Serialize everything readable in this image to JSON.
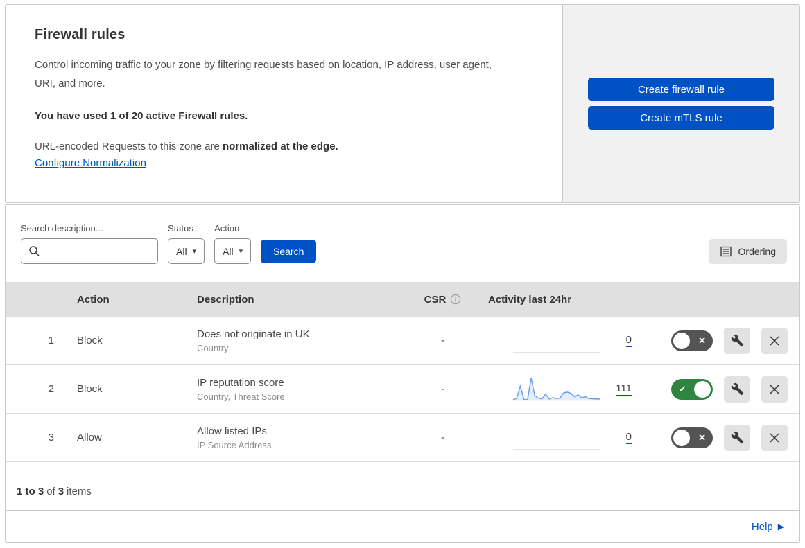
{
  "header": {
    "title": "Firewall rules",
    "description": "Control incoming traffic to your zone by filtering requests based on location, IP address, user agent, URI, and more.",
    "usage_text": "You have used 1 of 20 active Firewall rules.",
    "normalization_text": "URL-encoded Requests to this zone are ",
    "normalization_bold": "normalized at the edge.",
    "normalization_link": "Configure Normalization",
    "create_firewall_button": "Create firewall rule",
    "create_mtls_button": "Create mTLS rule"
  },
  "filters": {
    "search_label": "Search description...",
    "search_value": "",
    "status_label": "Status",
    "status_value": "All",
    "action_label": "Action",
    "action_value": "All",
    "search_button": "Search",
    "ordering_button": "Ordering"
  },
  "table": {
    "headers": {
      "action": "Action",
      "description": "Description",
      "csr": "CSR",
      "activity": "Activity last 24hr"
    },
    "rows": [
      {
        "num": "1",
        "action": "Block",
        "description": "Does not originate in UK",
        "criteria": "Country",
        "csr": "-",
        "activity_count": "0",
        "enabled": false,
        "sparkline": []
      },
      {
        "num": "2",
        "action": "Block",
        "description": "IP reputation score",
        "criteria": "Country, Threat Score",
        "csr": "-",
        "activity_count": "111",
        "enabled": true,
        "sparkline": [
          5,
          10,
          65,
          6,
          5,
          100,
          22,
          12,
          8,
          30,
          8,
          14,
          10,
          12,
          35,
          38,
          33,
          18,
          26,
          13,
          18,
          10,
          9,
          8,
          8
        ]
      },
      {
        "num": "3",
        "action": "Allow",
        "description": "Allow listed IPs",
        "criteria": "IP Source Address",
        "csr": "-",
        "activity_count": "0",
        "enabled": false,
        "sparkline": []
      }
    ]
  },
  "footer": {
    "range": "1 to 3",
    "of": "of",
    "total": "3",
    "items": "items",
    "help": "Help"
  },
  "icons": {
    "search": "magnifier",
    "dropdown_caret": "▾",
    "ordering": "list-box",
    "info": "circled-i",
    "wrench": "spanner",
    "delete": "x-cross",
    "toggle_on_mark": "✓",
    "toggle_off_mark": "✕",
    "help_arrow": "▶"
  },
  "colors": {
    "accent_blue": "#0051c3",
    "toggle_on_green": "#2e8540",
    "toggle_off_gray": "#545454",
    "spark_line": "#6d9fe8",
    "spark_fill": "rgba(109,159,232,0.18)",
    "spark_flat": "#b8b8b8",
    "panel_gray": "#f1f1f1",
    "table_header_gray": "#e0e0e0"
  }
}
